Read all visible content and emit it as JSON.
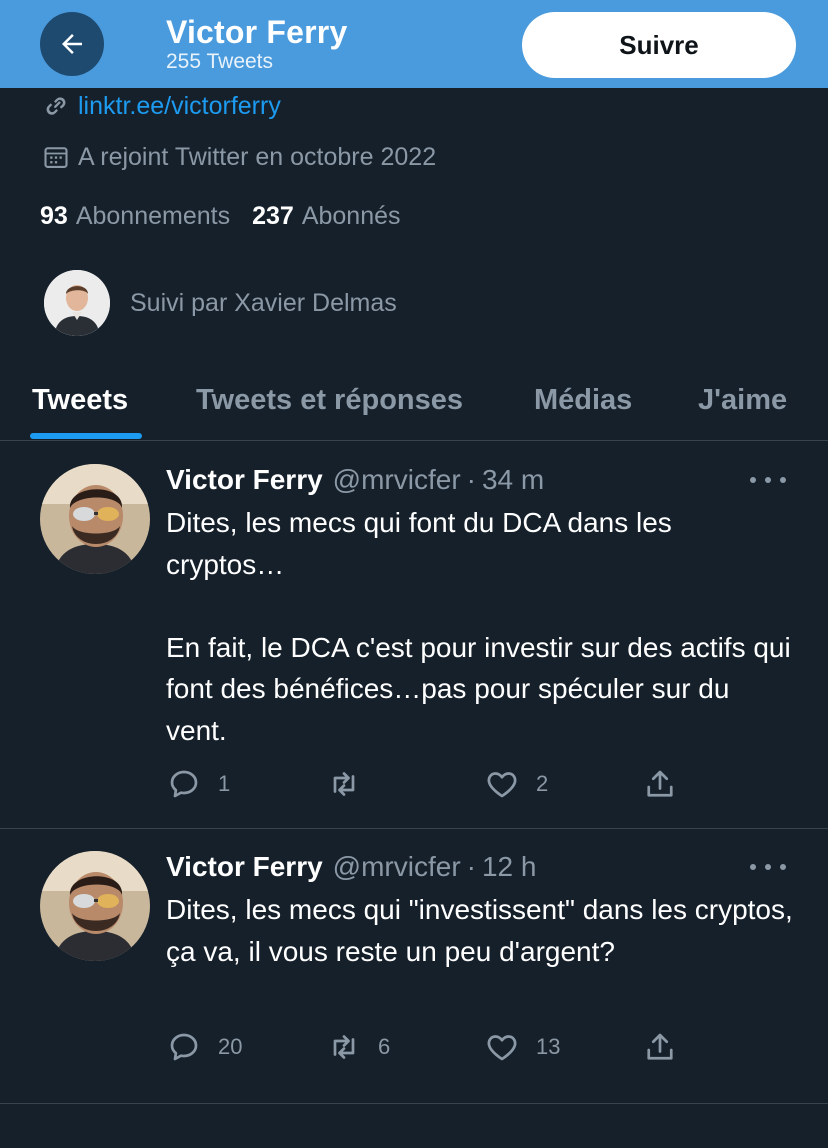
{
  "header": {
    "name": "Victor Ferry",
    "tweet_count": "255 Tweets",
    "follow_label": "Suivre"
  },
  "profile": {
    "link": "linktr.ee/victorferry",
    "joined": "A rejoint Twitter en octobre 2022",
    "following_count": "93",
    "following_label": "Abonnements",
    "followers_count": "237",
    "followers_label": "Abonnés",
    "followed_by": "Suivi par Xavier Delmas"
  },
  "tabs": [
    {
      "label": "Tweets",
      "active": true
    },
    {
      "label": "Tweets et réponses",
      "active": false
    },
    {
      "label": "Médias",
      "active": false
    },
    {
      "label": "J'aime",
      "active": false
    }
  ],
  "tweets": [
    {
      "name": "Victor Ferry",
      "handle": "@mrvicfer",
      "time": "34 m",
      "text": "Dites, les mecs qui font du DCA dans les cryptos…\n\nEn fait, le DCA c'est pour investir sur des actifs qui font des bénéfices…pas pour spéculer sur du vent.",
      "replies": "1",
      "retweets": "",
      "likes": "2"
    },
    {
      "name": "Victor Ferry",
      "handle": "@mrvicfer",
      "time": "12 h",
      "text": "Dites, les mecs qui \"investissent\" dans les cryptos, ça va, il vous reste un peu d'argent?",
      "replies": "20",
      "retweets": "6",
      "likes": "13"
    }
  ],
  "icons": {
    "back": "arrow-left-icon",
    "link": "link-icon",
    "calendar": "calendar-icon",
    "more": "more-horizontal-icon",
    "reply": "reply-icon",
    "retweet": "retweet-icon",
    "like": "heart-icon",
    "share": "share-icon"
  },
  "colors": {
    "background": "#15202b",
    "header": "#4a9bdd",
    "accent": "#1d9bf0",
    "muted": "#8b98a5"
  }
}
